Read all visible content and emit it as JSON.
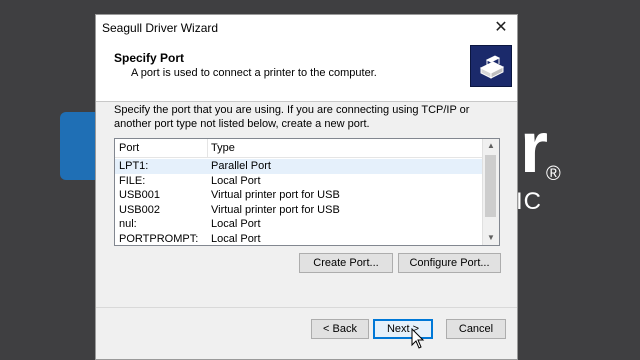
{
  "background": {
    "letter": "r",
    "registered": "®",
    "sub_text": "IC"
  },
  "dialog": {
    "title": "Seagull Driver Wizard",
    "close_glyph": "✕",
    "header": {
      "title": "Specify Port",
      "subtitle": "A port is used to connect a printer to the computer.",
      "icon": "printer-icon"
    },
    "description": "Specify the port that you are using.  If you are connecting using TCP/IP or another port type not listed below, create a new port.",
    "list": {
      "columns": [
        "Port",
        "Type"
      ],
      "rows": [
        {
          "port": "LPT1:",
          "type": "Parallel Port",
          "selected": true
        },
        {
          "port": "FILE:",
          "type": "Local Port",
          "selected": false
        },
        {
          "port": "USB001",
          "type": "Virtual printer port for USB",
          "selected": false
        },
        {
          "port": "USB002",
          "type": "Virtual printer port for USB",
          "selected": false
        },
        {
          "port": "nul:",
          "type": "Local Port",
          "selected": false
        },
        {
          "port": "PORTPROMPT:",
          "type": "Local Port",
          "selected": false
        }
      ]
    },
    "buttons": {
      "create_port": "Create Port...",
      "configure_port": "Configure Port...",
      "back": "< Back",
      "next": "Next >",
      "cancel": "Cancel"
    }
  },
  "colors": {
    "accent": "#0078d7",
    "header_icon_bg": "#1b2a6b",
    "splash_blue": "#1f6fb5"
  }
}
